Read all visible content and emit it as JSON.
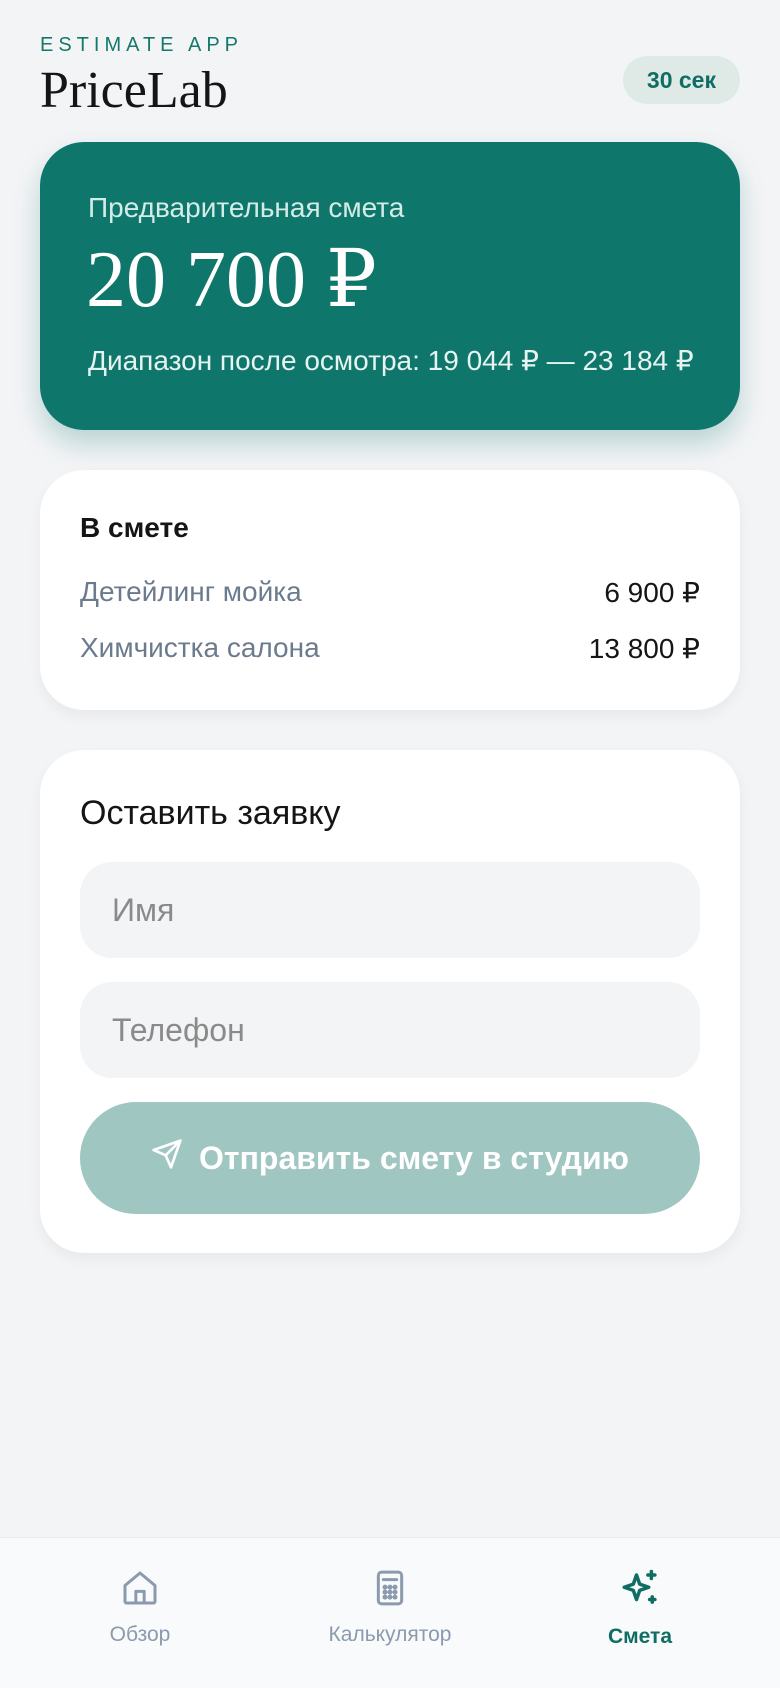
{
  "header": {
    "eyebrow": "ESTIMATE APP",
    "brand": "PriceLab",
    "timer": "30 сек"
  },
  "hero": {
    "label": "Предварительная смета",
    "amount": "20 700 ₽",
    "range": "Диапазон после осмотра: 19 044 ₽ — 23 184 ₽"
  },
  "items_card": {
    "title": "В смете",
    "items": [
      {
        "name": "Детейлинг мойка",
        "price": "6 900 ₽"
      },
      {
        "name": "Химчистка салона",
        "price": "13 800 ₽"
      }
    ]
  },
  "form": {
    "title": "Оставить заявку",
    "name_placeholder": "Имя",
    "phone_placeholder": "Телефон",
    "submit_label": "Отправить смету в студию"
  },
  "nav": {
    "items": [
      {
        "label": "Обзор",
        "icon": "home-icon"
      },
      {
        "label": "Калькулятор",
        "icon": "calculator-icon"
      },
      {
        "label": "Смета",
        "icon": "sparkle-icon",
        "active": true
      }
    ]
  },
  "colors": {
    "accent": "#0f766b",
    "accent_light": "#9fc6c1",
    "background": "#f3f4f6"
  }
}
